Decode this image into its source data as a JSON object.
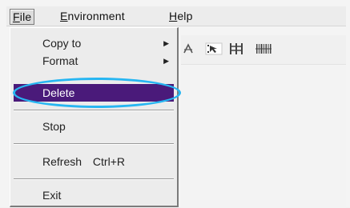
{
  "menubar": {
    "file_label": "File",
    "environment_label": "Environment",
    "help_label": "Help"
  },
  "file_menu": {
    "copy_to_label": "Copy to",
    "format_label": "Format",
    "delete_label": "Delete",
    "stop_label": "Stop",
    "refresh_label": "Refresh",
    "refresh_shortcut": "Ctrl+R",
    "exit_label": "Exit"
  },
  "colors": {
    "selected_bg": "#4a1a7a",
    "highlight_ring": "#27b6f2"
  },
  "toolbar": {
    "icons": [
      "cut-tool-icon",
      "pointer-tool-icon",
      "align-columns-icon",
      "barcode-icon"
    ]
  }
}
